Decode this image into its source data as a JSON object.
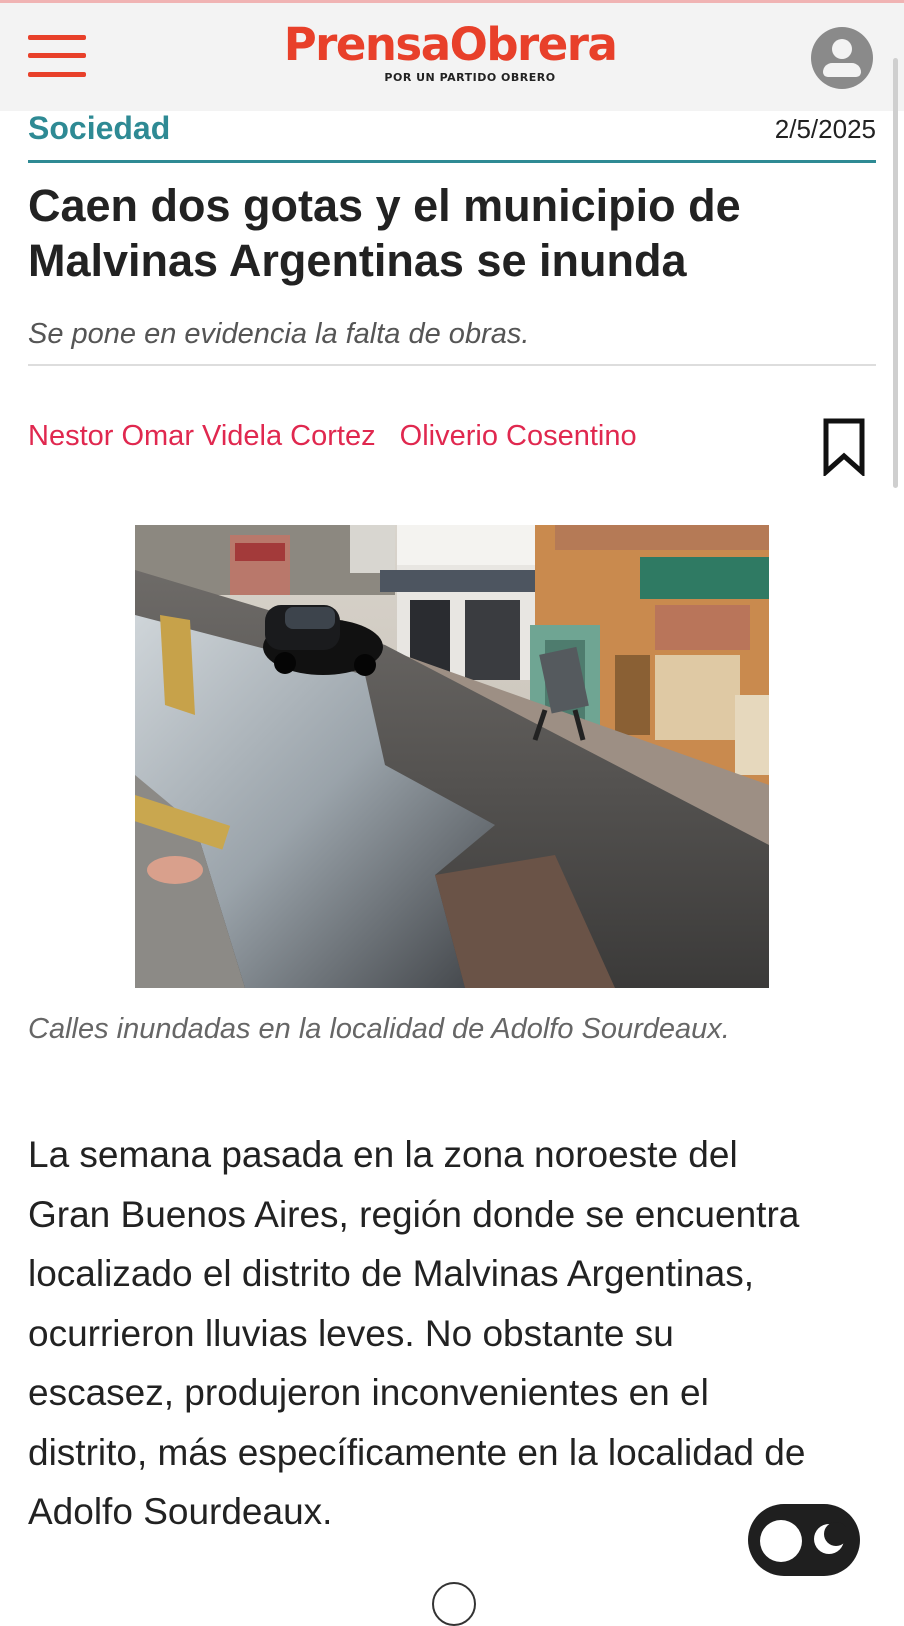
{
  "header": {
    "logo_text": "PrensaObrera",
    "logo_tagline": "POR UN PARTIDO OBRERO"
  },
  "article": {
    "section": "Sociedad",
    "date": "2/5/2025",
    "headline": "Caen dos gotas y el municipio de Malvinas Argentinas se inunda",
    "subtitle": "Se pone en evidencia la falta de obras.",
    "authors": [
      "Nestor Omar Videla Cortez",
      "Oliverio Cosentino"
    ],
    "image_caption": "Calles inundadas en la localidad de Adolfo Sourdeaux.",
    "body": "La semana pasada en la zona noroeste del Gran Buenos Aires, región donde se encuentra localizado el distrito de Malvinas Argentinas, ocurrieron lluvias leves. No obstante su escasez, produjeron inconvenientes en el distrito, más específicamente en la localidad de Adolfo Sourdeaux."
  },
  "colors": {
    "brand": "#e8402a",
    "section": "#2e8a94",
    "author": "#e0284f"
  },
  "icons": {
    "menu": "hamburger-menu-icon",
    "account": "user-avatar-icon",
    "bookmark": "bookmark-icon",
    "theme": "dark-mode-toggle-icon"
  }
}
